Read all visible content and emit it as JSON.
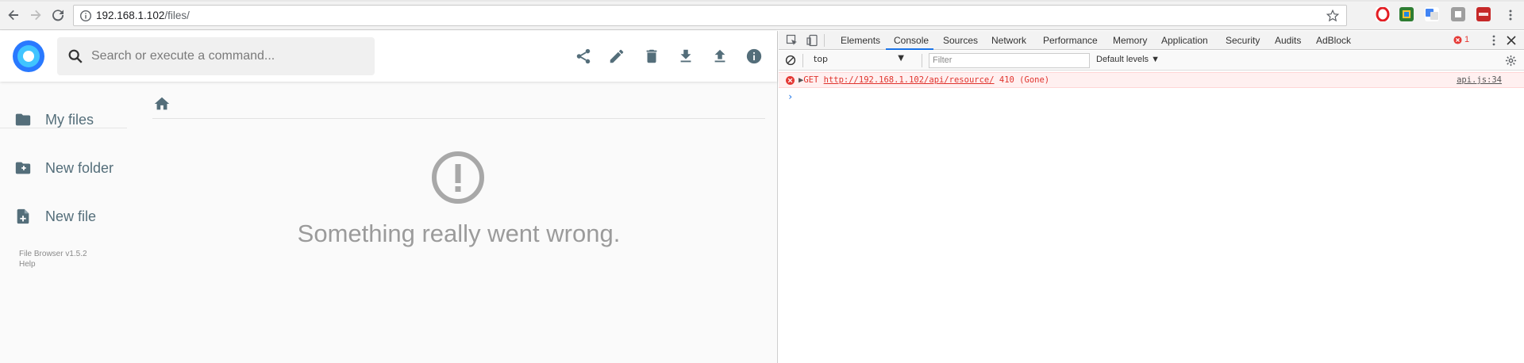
{
  "browser": {
    "url_host": "192.168.1.102",
    "url_path": "/files/"
  },
  "app": {
    "search_placeholder": "Search or execute a command...",
    "sidebar": {
      "items": [
        {
          "label": "My files",
          "icon": "folder-icon"
        },
        {
          "label": "New folder",
          "icon": "new-folder-icon"
        },
        {
          "label": "New file",
          "icon": "new-file-icon"
        }
      ],
      "version": "File Browser v1.5.2",
      "help": "Help"
    },
    "toolbar_icons": [
      "share-icon",
      "edit-icon",
      "delete-icon",
      "download-icon",
      "upload-icon",
      "info-icon"
    ],
    "error_message": "Something really went wrong.",
    "colors": {
      "logo": "#2979ff",
      "text": "#546e7a",
      "error": "#9b9b9b"
    }
  },
  "devtools": {
    "tabs": [
      "Elements",
      "Console",
      "Sources",
      "Network",
      "Performance",
      "Memory",
      "Application",
      "Security",
      "Audits",
      "AdBlock"
    ],
    "active_tab": "Console",
    "error_count": "1",
    "context": "top",
    "filter_placeholder": "Filter",
    "levels": "Default levels",
    "log": {
      "method": "GET",
      "url": "http://192.168.1.102/api/resource/",
      "status": "410 (Gone)",
      "source": "api.js:34"
    },
    "prompt": "›"
  }
}
